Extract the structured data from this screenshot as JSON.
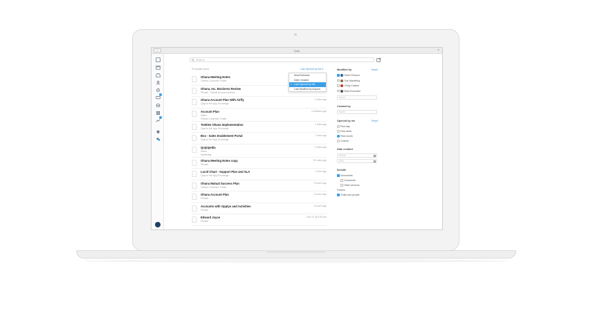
{
  "window": {
    "title": "Quip",
    "back_label": "<",
    "close_label": "×"
  },
  "search": {
    "placeholder": "Search"
  },
  "list": {
    "count_text": "20 results found",
    "sort_label": "Last Opened by Me ▾",
    "rows": [
      {
        "title": "Ohana Meeting Notes",
        "sub": "Ohana Customer Folder",
        "time": ""
      },
      {
        "title": "Ohana, Inc. Business Review",
        "sub": "Private · Global Account Access",
        "time": ""
      },
      {
        "title": "Ohana Account Plan With Airfly",
        "sub": "Quip in the App Exchange",
        "time": "3 mins ago"
      },
      {
        "title": "Account Plan",
        "sub": "Sales",
        "sub2": "Ohana Customer Folder",
        "time": "4 minutes ago"
      },
      {
        "title": "Teeblee Ohana Implementation",
        "sub": "Quip in the App Exchange",
        "time": "4 mins ago"
      },
      {
        "title": "Box - Sales Enablement Portal",
        "sub": "Quip in the App Exchange",
        "time": "7 mins ago"
      },
      {
        "title": "Quipipedia",
        "sub": "Sales",
        "sub2": "Marketing",
        "time": "9 mins ago"
      },
      {
        "title": "Ohana Meeting Notes copy",
        "sub": "Private",
        "time": "50 mins ago"
      },
      {
        "title": "Lucid Chart - Support Plan and SLA",
        "sub": "Quip in the App Exchange",
        "time": "1 hour ago"
      },
      {
        "title": "Ohana Mutual Success Plan",
        "sub": "Ohana Customer Folder",
        "time": "2 hours ago"
      },
      {
        "title": "Ohana Account Plan",
        "sub": "Private",
        "time": "2 hours ago"
      },
      {
        "title": "Accounts with Opptys and Activities",
        "sub": "Private",
        "time": "3 hours ago"
      },
      {
        "title": "Edward Joyce",
        "sub": "Private",
        "time": "Nov 27 at 6:35 pm"
      }
    ]
  },
  "sort_menu": {
    "items": [
      "Most Relevant",
      "Date Created",
      "Last Opened by Me",
      "Last Modified by Anyone"
    ],
    "selected_index": 2
  },
  "filters": {
    "modified_by": {
      "heading": "Modified by",
      "reset": "Reset",
      "users": [
        "Helen Product",
        "Sue Marketing",
        "Cindy Casline",
        "Brad Executive"
      ],
      "checked_index": 0,
      "input_placeholder": "Name"
    },
    "created_by": {
      "heading": "Created by",
      "input_placeholder": "Name"
    },
    "opened_by_me": {
      "heading": "Opened by me",
      "reset": "Reset",
      "options": [
        "Past day",
        "Past week",
        "Past month",
        "Custom"
      ],
      "selected_index": 2
    },
    "date_created": {
      "heading": "Date created",
      "before_placeholder": "Before",
      "after_placeholder": "After"
    },
    "include": {
      "heading": "Include",
      "options": [
        "Documents",
        "Comments",
        "Older versions",
        "Folders",
        "Chats and people"
      ],
      "checked": [
        true,
        false,
        false,
        false,
        true
      ]
    }
  },
  "colors": {
    "accent": "#3ba0e6",
    "nav_avatar": "#1f3f66"
  }
}
